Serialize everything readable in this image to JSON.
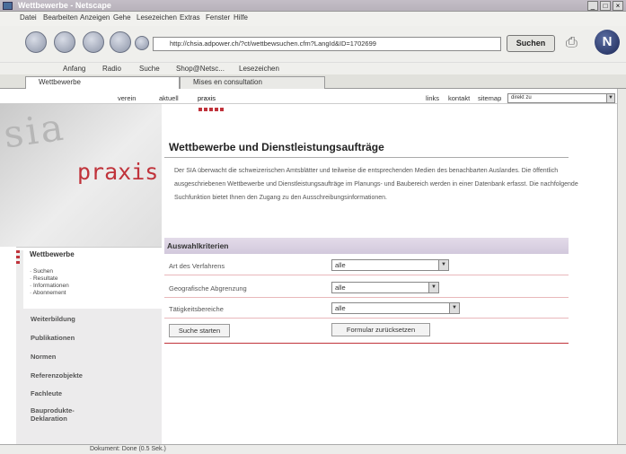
{
  "window": {
    "title": "Wettbewerbe - Netscape"
  },
  "menu": [
    "Datei",
    "Bearbeiten",
    "Anzeigen",
    "Gehe",
    "Lesezeichen",
    "Extras",
    "Fenster",
    "Hilfe"
  ],
  "toolbar": {
    "url": "http://chsia.adpower.ch/?ct/wettbewsuchen.cfm?LangId&ID=1702699",
    "search_label": "Suchen"
  },
  "personal_bar": [
    "Anfang",
    "Radio",
    "Suche",
    "Shop@Netsc...",
    "Lesezeichen"
  ],
  "tabs": [
    "Wettbewerbe",
    "Mises en consultation"
  ],
  "site": {
    "top_nav": [
      "verein",
      "aktuell",
      "praxis"
    ],
    "util_links": [
      "links",
      "kontakt",
      "sitemap"
    ],
    "direct_select": "direkt zu",
    "logo": {
      "sia": "sia",
      "praxis": "praxis"
    },
    "sidebar": {
      "section": "Wettbewerbe",
      "sub": [
        "Suchen",
        "Resultate",
        "Informationen",
        "Abonnement"
      ],
      "items": [
        "Weiterbildung",
        "Publikationen",
        "Normen",
        "Referenzobjekte",
        "Fachleute",
        "Bauprodukte-\nDeklaration"
      ]
    },
    "title": "Wettbewerbe und Dienstleistungsaufträge",
    "intro": "Der SIA überwacht die schweizerischen Amtsblätter und teilweise die entsprechenden Medien des benachbarten Auslandes. Die öffentlich ausgeschriebenen Wettbewerbe und Dienstleistungsaufträge im Planungs- und Baubereich werden in einer Datenbank erfasst. Die nachfolgende Suchfunktion bietet Ihnen den Zugang zu den Ausschreibungsinformationen.",
    "criteria_title": "Auswahlkriterien",
    "criteria": [
      {
        "label": "Art des Verfahrens",
        "value": "alle"
      },
      {
        "label": "Geografische Abgrenzung",
        "value": "alle"
      },
      {
        "label": "Tätigkeitsbereiche",
        "value": "alle"
      }
    ],
    "start_button": "Suche starten",
    "reset_button": "Formular zurücksetzen"
  },
  "status": "Dokument: Done (0.5 Sek.)"
}
